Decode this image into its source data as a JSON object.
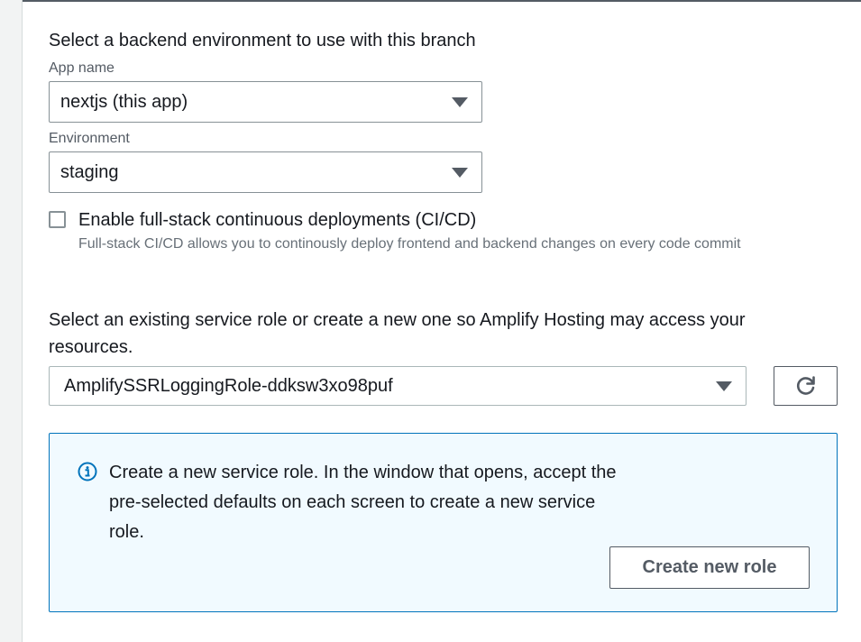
{
  "backend": {
    "heading": "Select a backend environment to use with this branch",
    "app_name_label": "App name",
    "app_name_value": "nextjs (this app)",
    "environment_label": "Environment",
    "environment_value": "staging"
  },
  "cicd": {
    "label": "Enable full-stack continuous deployments (CI/CD)",
    "description": "Full-stack CI/CD allows you to continously deploy frontend and backend changes on every code commit",
    "checked": false
  },
  "service_role": {
    "prompt": "Select an existing service role or create a new one so Amplify Hosting may access your resources.",
    "selected_role": "AmplifySSRLoggingRole-ddksw3xo98puf",
    "refresh_icon": "refresh-icon"
  },
  "info": {
    "icon": "info-icon",
    "text": "Create a new service role. In the window that opens, accept the pre-selected defaults on each screen to create a new service role.",
    "button_label": "Create new role"
  },
  "colors": {
    "info_border": "#0073bb",
    "info_background": "#f1faff",
    "control_border": "#879196",
    "secondary_text": "#687078"
  }
}
